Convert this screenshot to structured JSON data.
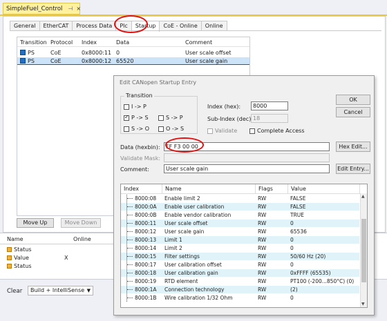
{
  "document": {
    "tab_title": "SimpleFuel_Control",
    "pin_glyph": "⊣",
    "close_glyph": "×"
  },
  "tabs": [
    {
      "label": "General"
    },
    {
      "label": "EtherCAT"
    },
    {
      "label": "Process Data"
    },
    {
      "label": "Plc"
    },
    {
      "label": "Startup",
      "active": true
    },
    {
      "label": "CoE - Online"
    },
    {
      "label": "Online"
    }
  ],
  "startup_list": {
    "headers": {
      "transition": "Transition",
      "protocol": "Protocol",
      "index": "Index",
      "data": "Data",
      "comment": "Comment"
    },
    "rows": [
      {
        "transition": "PS",
        "protocol": "CoE",
        "index": "0x8000:11",
        "data": "0",
        "comment": "User scale offset"
      },
      {
        "transition": "PS",
        "protocol": "CoE",
        "index": "0x8000:12",
        "data": "65520",
        "comment": "User scale gain",
        "selected": true
      }
    ]
  },
  "list_buttons": {
    "move_up": "Move Up",
    "move_down": "Move Down"
  },
  "lower_panel": {
    "headers": {
      "name": "Name",
      "online": "Online"
    },
    "rows": [
      {
        "name": "Status",
        "online": ""
      },
      {
        "name": "Value",
        "online": "X"
      },
      {
        "name": "Status",
        "online": ""
      }
    ]
  },
  "output_bar": {
    "clear_label": "Clear",
    "build_combo": "Build + IntelliSense"
  },
  "dialog": {
    "title": "Edit CANopen Startup Entry",
    "transition_group": "Transition",
    "transitions": [
      {
        "label": "I -> P",
        "checked": false
      },
      {
        "label": "P -> S",
        "checked": true
      },
      {
        "label": "S -> P",
        "checked": false
      },
      {
        "label": "S -> O",
        "checked": false
      },
      {
        "label": "O -> S",
        "checked": false
      }
    ],
    "index_label": "Index (hex):",
    "index_value": "8000",
    "subindex_label": "Sub-Index (dec):",
    "subindex_value": "18",
    "validate_label": "Validate",
    "complete_access_label": "Complete Access",
    "ok": "OK",
    "cancel": "Cancel",
    "data_label": "Data (hexbin):",
    "data_value": "FF F3 00 00",
    "hex_edit": "Hex Edit...",
    "validate_mask_label": "Validate Mask:",
    "validate_mask_value": "",
    "comment_label": "Comment:",
    "comment_value": "User scale gain",
    "edit_entry": "Edit Entry...",
    "grid": {
      "headers": {
        "index": "Index",
        "name": "Name",
        "flags": "Flags",
        "value": "Value"
      },
      "rows": [
        {
          "index": "8000:08",
          "name": "Enable limit 2",
          "flags": "RW",
          "value": "FALSE"
        },
        {
          "index": "8000:0A",
          "name": "Enable user calibration",
          "flags": "RW",
          "value": "FALSE"
        },
        {
          "index": "8000:0B",
          "name": "Enable vendor calibration",
          "flags": "RW",
          "value": "TRUE"
        },
        {
          "index": "8000:11",
          "name": "User scale offset",
          "flags": "RW",
          "value": "0"
        },
        {
          "index": "8000:12",
          "name": "User scale gain",
          "flags": "RW",
          "value": "65536"
        },
        {
          "index": "8000:13",
          "name": "Limit 1",
          "flags": "RW",
          "value": "0"
        },
        {
          "index": "8000:14",
          "name": "Limit 2",
          "flags": "RW",
          "value": "0"
        },
        {
          "index": "8000:15",
          "name": "Filter settings",
          "flags": "RW",
          "value": "50/60 Hz (20)"
        },
        {
          "index": "8000:17",
          "name": "User calibration offset",
          "flags": "RW",
          "value": "0"
        },
        {
          "index": "8000:18",
          "name": "User calibration gain",
          "flags": "RW",
          "value": "0xFFFF (65535)"
        },
        {
          "index": "8000:19",
          "name": "RTD element",
          "flags": "RW",
          "value": "PT100 (-200...850°C) (0)"
        },
        {
          "index": "8000:1A",
          "name": "Connection technology",
          "flags": "RW",
          "value": "(2)"
        },
        {
          "index": "8000:1B",
          "name": "Wire calibration 1/32 Ohm",
          "flags": "RW",
          "value": "0"
        }
      ]
    }
  },
  "colors": {
    "highlight_oval": "#e01212",
    "selection": "#cde3f7",
    "grid_alt_row": "#dff3f8",
    "doc_tab": "#fff19d"
  }
}
